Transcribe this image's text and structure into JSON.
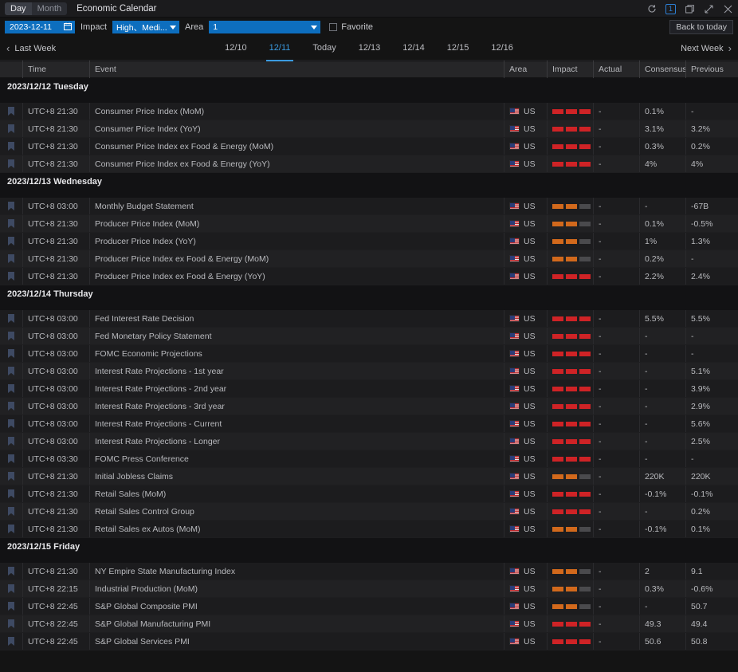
{
  "titlebar": {
    "segments": [
      {
        "label": "Day",
        "active": true
      },
      {
        "label": "Month",
        "active": false
      }
    ],
    "app_title": "Economic Calendar",
    "window_buttons": [
      {
        "name": "refresh-icon",
        "label": "↻"
      },
      {
        "name": "window-count-badge",
        "label": "1"
      },
      {
        "name": "restore-icon",
        "label": "❐"
      },
      {
        "name": "expand-icon",
        "label": "↗"
      },
      {
        "name": "close-icon",
        "label": "✕"
      }
    ]
  },
  "filterbar": {
    "date_value": "2023-12-11",
    "impact_label": "Impact",
    "impact_value": "High、Medi...",
    "area_label": "Area",
    "area_value": "1",
    "favorite_label": "Favorite",
    "back_to_today": "Back to today",
    "accent_color": "#0d6ebe"
  },
  "weeknav": {
    "last_week": "Last Week",
    "next_week": "Next Week",
    "days": [
      {
        "label": "12/10",
        "active": false
      },
      {
        "label": "12/11",
        "active": true
      },
      {
        "label": "Today",
        "active": false
      },
      {
        "label": "12/13",
        "active": false
      },
      {
        "label": "12/14",
        "active": false
      },
      {
        "label": "12/15",
        "active": false
      },
      {
        "label": "12/16",
        "active": false
      }
    ],
    "active_color": "#3a9ae0"
  },
  "table": {
    "columns": [
      "",
      "Time",
      "Event",
      "Area",
      "Impact",
      "Actual",
      "Consensus",
      "Previous"
    ],
    "impact_colors": {
      "high": "#cf2326",
      "medium": "#d2691c",
      "empty": "#4a4a4d"
    },
    "groups": [
      {
        "date": "2023/12/12 Tuesday",
        "rows": [
          {
            "time": "UTC+8 21:30",
            "event": "Consumer Price Index (MoM)",
            "area": "US",
            "impact": "high",
            "actual": "-",
            "consensus": "0.1%",
            "previous": "-"
          },
          {
            "time": "UTC+8 21:30",
            "event": "Consumer Price Index (YoY)",
            "area": "US",
            "impact": "high",
            "actual": "-",
            "consensus": "3.1%",
            "previous": "3.2%"
          },
          {
            "time": "UTC+8 21:30",
            "event": "Consumer Price Index ex Food & Energy (MoM)",
            "area": "US",
            "impact": "high",
            "actual": "-",
            "consensus": "0.3%",
            "previous": "0.2%"
          },
          {
            "time": "UTC+8 21:30",
            "event": "Consumer Price Index ex Food & Energy (YoY)",
            "area": "US",
            "impact": "high",
            "actual": "-",
            "consensus": "4%",
            "previous": "4%"
          }
        ]
      },
      {
        "date": "2023/12/13 Wednesday",
        "rows": [
          {
            "time": "UTC+8 03:00",
            "event": "Monthly Budget Statement",
            "area": "US",
            "impact": "medium",
            "actual": "-",
            "consensus": "-",
            "previous": "-67B"
          },
          {
            "time": "UTC+8 21:30",
            "event": "Producer Price Index (MoM)",
            "area": "US",
            "impact": "medium",
            "actual": "-",
            "consensus": "0.1%",
            "previous": "-0.5%"
          },
          {
            "time": "UTC+8 21:30",
            "event": "Producer Price Index (YoY)",
            "area": "US",
            "impact": "medium",
            "actual": "-",
            "consensus": "1%",
            "previous": "1.3%"
          },
          {
            "time": "UTC+8 21:30",
            "event": "Producer Price Index ex Food & Energy (MoM)",
            "area": "US",
            "impact": "medium",
            "actual": "-",
            "consensus": "0.2%",
            "previous": "-"
          },
          {
            "time": "UTC+8 21:30",
            "event": "Producer Price Index ex Food & Energy (YoY)",
            "area": "US",
            "impact": "high",
            "actual": "-",
            "consensus": "2.2%",
            "previous": "2.4%"
          }
        ]
      },
      {
        "date": "2023/12/14 Thursday",
        "rows": [
          {
            "time": "UTC+8 03:00",
            "event": "Fed Interest Rate Decision",
            "area": "US",
            "impact": "high",
            "actual": "-",
            "consensus": "5.5%",
            "previous": "5.5%"
          },
          {
            "time": "UTC+8 03:00",
            "event": "Fed Monetary Policy Statement",
            "area": "US",
            "impact": "high",
            "actual": "-",
            "consensus": "-",
            "previous": "-"
          },
          {
            "time": "UTC+8 03:00",
            "event": "FOMC Economic Projections",
            "area": "US",
            "impact": "high",
            "actual": "-",
            "consensus": "-",
            "previous": "-"
          },
          {
            "time": "UTC+8 03:00",
            "event": "Interest Rate Projections - 1st year",
            "area": "US",
            "impact": "high",
            "actual": "-",
            "consensus": "-",
            "previous": "5.1%"
          },
          {
            "time": "UTC+8 03:00",
            "event": "Interest Rate Projections - 2nd year",
            "area": "US",
            "impact": "high",
            "actual": "-",
            "consensus": "-",
            "previous": "3.9%"
          },
          {
            "time": "UTC+8 03:00",
            "event": "Interest Rate Projections - 3rd year",
            "area": "US",
            "impact": "high",
            "actual": "-",
            "consensus": "-",
            "previous": "2.9%"
          },
          {
            "time": "UTC+8 03:00",
            "event": "Interest Rate Projections - Current",
            "area": "US",
            "impact": "high",
            "actual": "-",
            "consensus": "-",
            "previous": "5.6%"
          },
          {
            "time": "UTC+8 03:00",
            "event": "Interest Rate Projections - Longer",
            "area": "US",
            "impact": "high",
            "actual": "-",
            "consensus": "-",
            "previous": "2.5%"
          },
          {
            "time": "UTC+8 03:30",
            "event": "FOMC Press Conference",
            "area": "US",
            "impact": "high",
            "actual": "-",
            "consensus": "-",
            "previous": "-"
          },
          {
            "time": "UTC+8 21:30",
            "event": "Initial Jobless Claims",
            "area": "US",
            "impact": "medium",
            "actual": "-",
            "consensus": "220K",
            "previous": "220K"
          },
          {
            "time": "UTC+8 21:30",
            "event": "Retail Sales (MoM)",
            "area": "US",
            "impact": "high",
            "actual": "-",
            "consensus": "-0.1%",
            "previous": "-0.1%"
          },
          {
            "time": "UTC+8 21:30",
            "event": "Retail Sales Control Group",
            "area": "US",
            "impact": "high",
            "actual": "-",
            "consensus": "-",
            "previous": "0.2%"
          },
          {
            "time": "UTC+8 21:30",
            "event": "Retail Sales ex Autos (MoM)",
            "area": "US",
            "impact": "medium",
            "actual": "-",
            "consensus": "-0.1%",
            "previous": "0.1%"
          }
        ]
      },
      {
        "date": "2023/12/15 Friday",
        "rows": [
          {
            "time": "UTC+8 21:30",
            "event": "NY Empire State Manufacturing Index",
            "area": "US",
            "impact": "medium",
            "actual": "-",
            "consensus": "2",
            "previous": "9.1"
          },
          {
            "time": "UTC+8 22:15",
            "event": "Industrial Production (MoM)",
            "area": "US",
            "impact": "medium",
            "actual": "-",
            "consensus": "0.3%",
            "previous": "-0.6%"
          },
          {
            "time": "UTC+8 22:45",
            "event": "S&P Global Composite PMI",
            "area": "US",
            "impact": "medium",
            "actual": "-",
            "consensus": "-",
            "previous": "50.7"
          },
          {
            "time": "UTC+8 22:45",
            "event": "S&P Global Manufacturing PMI",
            "area": "US",
            "impact": "high",
            "actual": "-",
            "consensus": "49.3",
            "previous": "49.4"
          },
          {
            "time": "UTC+8 22:45",
            "event": "S&P Global Services PMI",
            "area": "US",
            "impact": "high",
            "actual": "-",
            "consensus": "50.6",
            "previous": "50.8"
          }
        ]
      }
    ]
  }
}
